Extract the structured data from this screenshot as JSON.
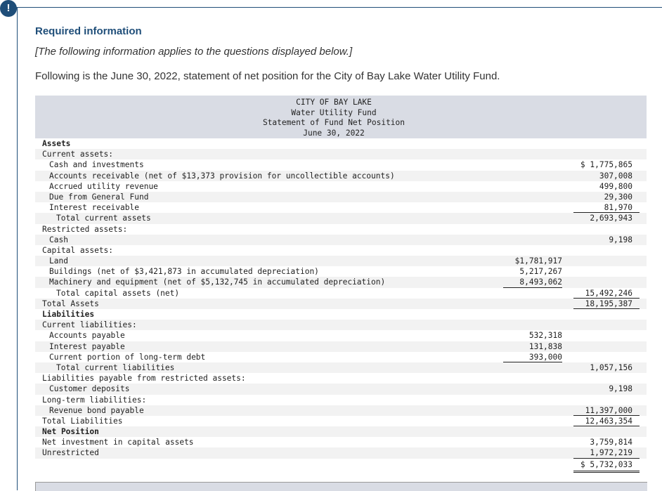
{
  "alert": {
    "icon": "!"
  },
  "required_title": "Required information",
  "intro_italic": "[The following information applies to the questions displayed below.]",
  "intro_text": "Following is the June 30, 2022, statement of net position for the City of Bay Lake Water Utility Fund.",
  "statement": {
    "header": [
      "CITY OF BAY LAKE",
      "Water Utility Fund",
      "Statement of Fund Net Position",
      "June 30, 2022"
    ],
    "rows": [
      {
        "label": "Assets",
        "indent": 0,
        "bold": true,
        "c1": "",
        "c2": ""
      },
      {
        "label": "Current assets:",
        "indent": 0,
        "c1": "",
        "c2": ""
      },
      {
        "label": "Cash and investments",
        "indent": 1,
        "c1": "",
        "c2": "$ 1,775,865"
      },
      {
        "label": "Accounts receivable (net of $13,373 provision for uncollectible accounts)",
        "indent": 1,
        "c1": "",
        "c2": "307,008"
      },
      {
        "label": "Accrued utility revenue",
        "indent": 1,
        "c1": "",
        "c2": "499,800"
      },
      {
        "label": "Due from General Fund",
        "indent": 1,
        "c1": "",
        "c2": "29,300"
      },
      {
        "label": "Interest receivable",
        "indent": 1,
        "c1": "",
        "c2": "81,970",
        "ul2": true
      },
      {
        "label": "Total current assets",
        "indent": 2,
        "c1": "",
        "c2": "2,693,943"
      },
      {
        "label": "Restricted assets:",
        "indent": 0,
        "c1": "",
        "c2": ""
      },
      {
        "label": "Cash",
        "indent": 1,
        "c1": "",
        "c2": "9,198"
      },
      {
        "label": "Capital assets:",
        "indent": 0,
        "c1": "",
        "c2": ""
      },
      {
        "label": "Land",
        "indent": 1,
        "c1": "$1,781,917",
        "c2": ""
      },
      {
        "label": "Buildings (net of $3,421,873 in accumulated depreciation)",
        "indent": 1,
        "c1": "5,217,267",
        "c2": ""
      },
      {
        "label": "Machinery and equipment (net of $5,132,745 in accumulated depreciation)",
        "indent": 1,
        "c1": "8,493,062",
        "c2": "",
        "ul1": true
      },
      {
        "label": "Total capital assets (net)",
        "indent": 2,
        "c1": "",
        "c2": "15,492,246",
        "ul2": true
      },
      {
        "label": "Total Assets",
        "indent": 0,
        "c1": "",
        "c2": "18,195,387",
        "ul2": true
      },
      {
        "label": "Liabilities",
        "indent": 0,
        "bold": true,
        "c1": "",
        "c2": ""
      },
      {
        "label": "Current liabilities:",
        "indent": 0,
        "c1": "",
        "c2": ""
      },
      {
        "label": "Accounts payable",
        "indent": 1,
        "c1": "532,318",
        "c2": ""
      },
      {
        "label": "Interest payable",
        "indent": 1,
        "c1": "131,838",
        "c2": ""
      },
      {
        "label": "Current portion of long-term debt",
        "indent": 1,
        "c1": "393,000",
        "c2": "",
        "ul1": true
      },
      {
        "label": "Total current liabilities",
        "indent": 2,
        "c1": "",
        "c2": "1,057,156"
      },
      {
        "label": "Liabilities payable from restricted assets:",
        "indent": 0,
        "c1": "",
        "c2": ""
      },
      {
        "label": "Customer deposits",
        "indent": 1,
        "c1": "",
        "c2": "9,198"
      },
      {
        "label": "Long-term liabilities:",
        "indent": 0,
        "c1": "",
        "c2": ""
      },
      {
        "label": "Revenue bond payable",
        "indent": 1,
        "c1": "",
        "c2": "11,397,000",
        "ul2": true
      },
      {
        "label": "Total Liabilities",
        "indent": 0,
        "c1": "",
        "c2": "12,463,354",
        "ul2": true
      },
      {
        "label": "Net Position",
        "indent": 0,
        "bold": true,
        "c1": "",
        "c2": ""
      },
      {
        "label": "Net investment in capital assets",
        "indent": 0,
        "c1": "",
        "c2": "3,759,814"
      },
      {
        "label": "Unrestricted",
        "indent": 0,
        "c1": "",
        "c2": "1,972,219",
        "ul2": true
      },
      {
        "label": "",
        "indent": 0,
        "c1": "",
        "c2": "$ 5,732,033",
        "dbl2": true
      }
    ]
  }
}
